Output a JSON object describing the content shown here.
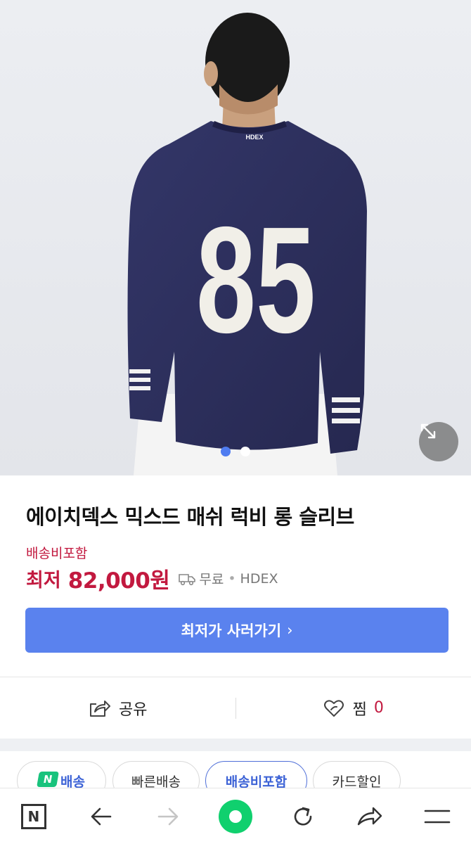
{
  "hero": {
    "jersey_brand": "HDEX",
    "jersey_number": "85",
    "active_slide": 1,
    "slide_count": 2
  },
  "product": {
    "title": "에이치덱스 믹스드 매쉬 럭비 롱 슬리브",
    "shipping_label": "배송비포함",
    "price_prefix": "최저",
    "price": "82,000원",
    "shipping_fee": "무료",
    "separator": "•",
    "seller": "HDEX",
    "cta_label": "최저가 사러가기",
    "cta_chevron": "›"
  },
  "actions": {
    "share_label": "공유",
    "like_label": "찜",
    "like_count": "0"
  },
  "chips": [
    {
      "label": "배송",
      "badge": "N",
      "active": false
    },
    {
      "label": "빠른배송",
      "active": false
    },
    {
      "label": "배송비포함",
      "active": true
    },
    {
      "label": "카드할인",
      "active": false
    }
  ],
  "colors": {
    "accent_blue": "#5a82ee",
    "price_red": "#c2193f",
    "naver_green": "#10d06e",
    "jersey_navy": "#2c2e5e"
  },
  "icons": [
    "expand-icon",
    "truck-icon",
    "share-icon",
    "heart-icon",
    "naver-home-icon",
    "back-arrow-icon",
    "forward-arrow-icon",
    "green-dot-icon",
    "refresh-icon",
    "share-arrow-icon",
    "menu-icon"
  ]
}
